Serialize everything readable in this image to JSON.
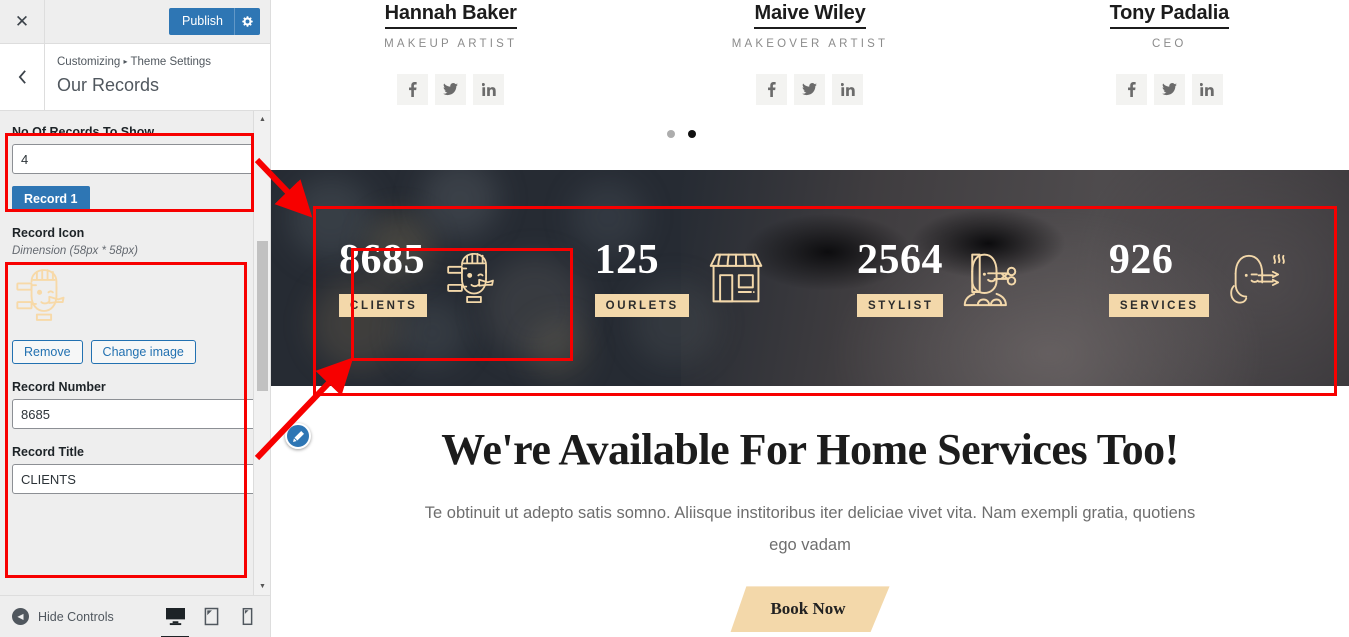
{
  "customizer": {
    "close_label": "✕",
    "publish_label": "Publish",
    "gear_icon": "gear-icon",
    "back_icon": "chevron-left-icon",
    "breadcrumb_root": "Customizing",
    "breadcrumb_sep": "▸",
    "breadcrumb_section": "Theme Settings",
    "panel_title": "Our Records",
    "controls": {
      "records_count_label": "No Of Records To Show",
      "records_count_value": "4",
      "record_tab_label": "Record 1",
      "record_icon_label": "Record Icon",
      "record_icon_dimension": "Dimension (58px * 58px)",
      "remove_label": "Remove",
      "change_image_label": "Change image",
      "record_number_label": "Record Number",
      "record_number_value": "8685",
      "record_title_label": "Record Title",
      "record_title_value": "CLIENTS"
    },
    "footer": {
      "hide_controls_label": "Hide Controls",
      "devices": [
        {
          "name": "desktop",
          "active": true
        },
        {
          "name": "tablet",
          "active": false
        },
        {
          "name": "mobile",
          "active": false
        }
      ]
    },
    "colors": {
      "accent": "#2e76b4",
      "panel_bg": "#eeeeee",
      "annotation": "#f70000"
    }
  },
  "preview": {
    "team": [
      {
        "name": "Hannah Baker",
        "role": "MAKEUP ARTIST",
        "socials": [
          "facebook-icon",
          "twitter-icon",
          "linkedin-icon"
        ]
      },
      {
        "name": "Maive Wiley",
        "role": "MAKEOVER ARTIST",
        "socials": [
          "facebook-icon",
          "twitter-icon",
          "linkedin-icon"
        ]
      },
      {
        "name": "Tony Padalia",
        "role": "CEO",
        "socials": [
          "facebook-icon",
          "twitter-icon",
          "linkedin-icon"
        ]
      }
    ],
    "carousel_dots": [
      {
        "active": false
      },
      {
        "active": true
      }
    ],
    "counters": [
      {
        "number": "8685",
        "label": "CLIENTS",
        "icon": "makeup-face-icon"
      },
      {
        "number": "125",
        "label": "OURLETS",
        "icon": "storefront-icon"
      },
      {
        "number": "2564",
        "label": "STYLIST",
        "icon": "hairstylist-scissors-icon"
      },
      {
        "number": "926",
        "label": "SERVICES",
        "icon": "hair-styling-icon"
      }
    ],
    "counter_colors": {
      "badge": "#f3d8aa",
      "number": "#ffffff",
      "bg": "#262b33"
    },
    "home_services": {
      "title": "We're Available For Home Services Too!",
      "description": "Te obtinuit ut adepto satis somno. Aliisque institoribus iter deliciae vivet vita. Nam exempli gratia, quotiens ego vadam",
      "button_label": "Book Now"
    },
    "edit_icon": "pencil-edit-icon"
  }
}
